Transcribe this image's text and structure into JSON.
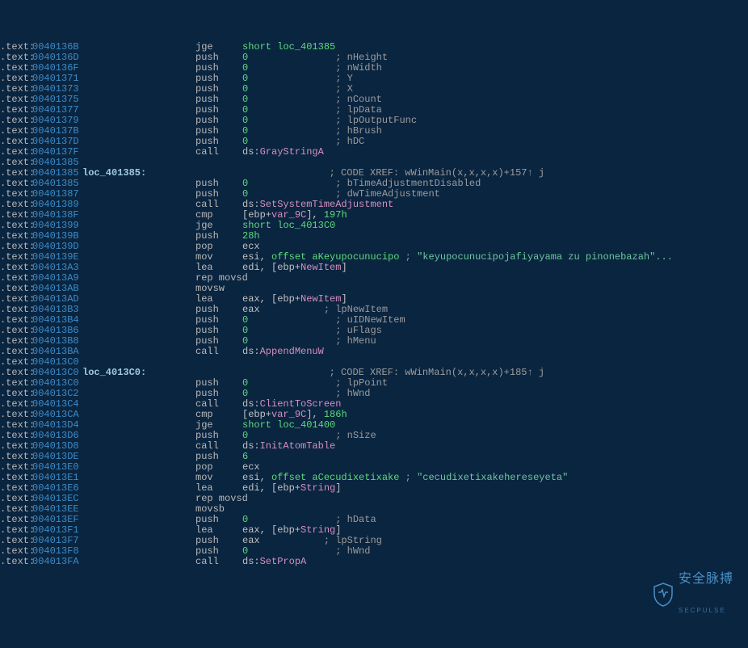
{
  "chart_data": null,
  "watermark": {
    "cn": "安全脉搏",
    "en": "SECPULSE"
  },
  "lines": [
    {
      "a": "0040136B",
      "m": "jge",
      "ops": [
        {
          "t": "kw",
          "v": "short loc_401385"
        }
      ]
    },
    {
      "a": "0040136D",
      "m": "push",
      "ops": [
        {
          "t": "num",
          "v": "0"
        }
      ],
      "pad": 16,
      "c": "; nHeight"
    },
    {
      "a": "0040136F",
      "m": "push",
      "ops": [
        {
          "t": "num",
          "v": "0"
        }
      ],
      "pad": 16,
      "c": "; nWidth"
    },
    {
      "a": "00401371",
      "m": "push",
      "ops": [
        {
          "t": "num",
          "v": "0"
        }
      ],
      "pad": 16,
      "c": "; Y"
    },
    {
      "a": "00401373",
      "m": "push",
      "ops": [
        {
          "t": "num",
          "v": "0"
        }
      ],
      "pad": 16,
      "c": "; X"
    },
    {
      "a": "00401375",
      "m": "push",
      "ops": [
        {
          "t": "num",
          "v": "0"
        }
      ],
      "pad": 16,
      "c": "; nCount"
    },
    {
      "a": "00401377",
      "m": "push",
      "ops": [
        {
          "t": "num",
          "v": "0"
        }
      ],
      "pad": 16,
      "c": "; lpData"
    },
    {
      "a": "00401379",
      "m": "push",
      "ops": [
        {
          "t": "num",
          "v": "0"
        }
      ],
      "pad": 16,
      "c": "; lpOutputFunc"
    },
    {
      "a": "0040137B",
      "m": "push",
      "ops": [
        {
          "t": "num",
          "v": "0"
        }
      ],
      "pad": 16,
      "c": "; hBrush"
    },
    {
      "a": "0040137D",
      "m": "push",
      "ops": [
        {
          "t": "num",
          "v": "0"
        }
      ],
      "pad": 16,
      "c": "; hDC"
    },
    {
      "a": "0040137F",
      "m": "call",
      "ops": [
        {
          "t": "plain",
          "v": "ds:"
        },
        {
          "t": "sym",
          "v": "GrayStringA"
        }
      ]
    },
    {
      "a": "00401385"
    },
    {
      "a": "00401385",
      "lbl": "loc_401385:",
      "xrefpad": 23,
      "xref": "; CODE XREF: wWinMain(x,x,x,x)+157",
      "xrefarrow": "↑ j"
    },
    {
      "a": "00401385",
      "m": "push",
      "ops": [
        {
          "t": "num",
          "v": "0"
        }
      ],
      "pad": 16,
      "c": "; bTimeAdjustmentDisabled"
    },
    {
      "a": "00401387",
      "m": "push",
      "ops": [
        {
          "t": "num",
          "v": "0"
        }
      ],
      "pad": 16,
      "c": "; dwTimeAdjustment"
    },
    {
      "a": "00401389",
      "m": "call",
      "ops": [
        {
          "t": "plain",
          "v": "ds:"
        },
        {
          "t": "sym",
          "v": "SetSystemTimeAdjustment"
        }
      ]
    },
    {
      "a": "0040138F",
      "m": "cmp",
      "ops": [
        {
          "t": "plain",
          "v": "[ebp+"
        },
        {
          "t": "var",
          "v": "var_9C"
        },
        {
          "t": "plain",
          "v": "], "
        },
        {
          "t": "num",
          "v": "197h"
        }
      ]
    },
    {
      "a": "00401399",
      "m": "jge",
      "ops": [
        {
          "t": "kw",
          "v": "short loc_4013C0"
        }
      ]
    },
    {
      "a": "0040139B",
      "m": "push",
      "ops": [
        {
          "t": "num",
          "v": "28h"
        }
      ]
    },
    {
      "a": "0040139D",
      "m": "pop",
      "ops": [
        {
          "t": "plain",
          "v": "ecx"
        }
      ]
    },
    {
      "a": "0040139E",
      "m": "mov",
      "ops": [
        {
          "t": "plain",
          "v": "esi, "
        },
        {
          "t": "kw",
          "v": "offset aKeyupocunucipo"
        },
        {
          "t": "plain",
          "v": " "
        },
        {
          "t": "comment",
          "v": "; "
        },
        {
          "t": "str",
          "v": "\"keyupocunucipojafiyayama zu pinonebazah\"..."
        }
      ]
    },
    {
      "a": "004013A3",
      "m": "lea",
      "ops": [
        {
          "t": "plain",
          "v": "edi, [ebp+"
        },
        {
          "t": "var",
          "v": "NewItem"
        },
        {
          "t": "plain",
          "v": "]"
        }
      ]
    },
    {
      "a": "004013A9",
      "m": "rep movsd"
    },
    {
      "a": "004013AB",
      "m": "movsw"
    },
    {
      "a": "004013AD",
      "m": "lea",
      "ops": [
        {
          "t": "plain",
          "v": "eax, [ebp+"
        },
        {
          "t": "var",
          "v": "NewItem"
        },
        {
          "t": "plain",
          "v": "]"
        }
      ]
    },
    {
      "a": "004013B3",
      "m": "push",
      "ops": [
        {
          "t": "plain",
          "v": "eax"
        }
      ],
      "pad": 14,
      "c": "; lpNewItem"
    },
    {
      "a": "004013B4",
      "m": "push",
      "ops": [
        {
          "t": "num",
          "v": "0"
        }
      ],
      "pad": 16,
      "c": "; uIDNewItem"
    },
    {
      "a": "004013B6",
      "m": "push",
      "ops": [
        {
          "t": "num",
          "v": "0"
        }
      ],
      "pad": 16,
      "c": "; uFlags"
    },
    {
      "a": "004013B8",
      "m": "push",
      "ops": [
        {
          "t": "num",
          "v": "0"
        }
      ],
      "pad": 16,
      "c": "; hMenu"
    },
    {
      "a": "004013BA",
      "m": "call",
      "ops": [
        {
          "t": "plain",
          "v": "ds:"
        },
        {
          "t": "sym",
          "v": "AppendMenuW"
        }
      ]
    },
    {
      "a": "004013C0"
    },
    {
      "a": "004013C0",
      "lbl": "loc_4013C0:",
      "xrefpad": 23,
      "xref": "; CODE XREF: wWinMain(x,x,x,x)+185",
      "xrefarrow": "↑ j"
    },
    {
      "a": "004013C0",
      "m": "push",
      "ops": [
        {
          "t": "num",
          "v": "0"
        }
      ],
      "pad": 16,
      "c": "; lpPoint"
    },
    {
      "a": "004013C2",
      "m": "push",
      "ops": [
        {
          "t": "num",
          "v": "0"
        }
      ],
      "pad": 16,
      "c": "; hWnd"
    },
    {
      "a": "004013C4",
      "m": "call",
      "ops": [
        {
          "t": "plain",
          "v": "ds:"
        },
        {
          "t": "sym",
          "v": "ClientToScreen"
        }
      ]
    },
    {
      "a": "004013CA",
      "m": "cmp",
      "ops": [
        {
          "t": "plain",
          "v": "[ebp+"
        },
        {
          "t": "var",
          "v": "var_9C"
        },
        {
          "t": "plain",
          "v": "], "
        },
        {
          "t": "num",
          "v": "186h"
        }
      ]
    },
    {
      "a": "004013D4",
      "m": "jge",
      "ops": [
        {
          "t": "kw",
          "v": "short loc_401400"
        }
      ]
    },
    {
      "a": "004013D6",
      "m": "push",
      "ops": [
        {
          "t": "num",
          "v": "0"
        }
      ],
      "pad": 16,
      "c": "; nSize"
    },
    {
      "a": "004013D8",
      "m": "call",
      "ops": [
        {
          "t": "plain",
          "v": "ds:"
        },
        {
          "t": "sym",
          "v": "InitAtomTable"
        }
      ]
    },
    {
      "a": "004013DE",
      "m": "push",
      "ops": [
        {
          "t": "num",
          "v": "6"
        }
      ]
    },
    {
      "a": "004013E0",
      "m": "pop",
      "ops": [
        {
          "t": "plain",
          "v": "ecx"
        }
      ]
    },
    {
      "a": "004013E1",
      "m": "mov",
      "ops": [
        {
          "t": "plain",
          "v": "esi, "
        },
        {
          "t": "kw",
          "v": "offset aCecudixetixake"
        },
        {
          "t": "plain",
          "v": " "
        },
        {
          "t": "comment",
          "v": "; "
        },
        {
          "t": "str",
          "v": "\"cecudixetixakehereseyeta\""
        }
      ]
    },
    {
      "a": "004013E6",
      "m": "lea",
      "ops": [
        {
          "t": "plain",
          "v": "edi, [ebp+"
        },
        {
          "t": "var",
          "v": "String"
        },
        {
          "t": "plain",
          "v": "]"
        }
      ]
    },
    {
      "a": "004013EC",
      "m": "rep movsd"
    },
    {
      "a": "004013EE",
      "m": "movsb"
    },
    {
      "a": "004013EF",
      "m": "push",
      "ops": [
        {
          "t": "num",
          "v": "0"
        }
      ],
      "pad": 16,
      "c": "; hData"
    },
    {
      "a": "004013F1",
      "m": "lea",
      "ops": [
        {
          "t": "plain",
          "v": "eax, [ebp+"
        },
        {
          "t": "var",
          "v": "String"
        },
        {
          "t": "plain",
          "v": "]"
        }
      ]
    },
    {
      "a": "004013F7",
      "m": "push",
      "ops": [
        {
          "t": "plain",
          "v": "eax"
        }
      ],
      "pad": 14,
      "c": "; lpString"
    },
    {
      "a": "004013F8",
      "m": "push",
      "ops": [
        {
          "t": "num",
          "v": "0"
        }
      ],
      "pad": 16,
      "c": "; hWnd"
    },
    {
      "a": "004013FA",
      "m": "call",
      "ops": [
        {
          "t": "plain",
          "v": "ds:"
        },
        {
          "t": "sym",
          "v": "SetPropA"
        }
      ]
    }
  ]
}
